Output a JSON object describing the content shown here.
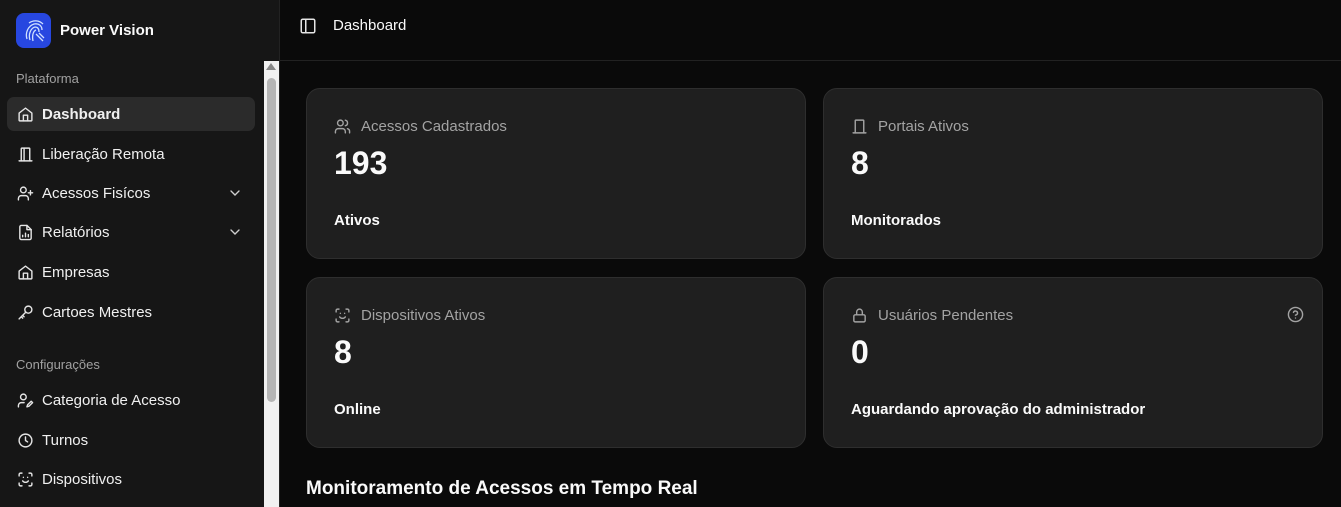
{
  "brand": {
    "name": "Power Vision"
  },
  "sidebar": {
    "groups": [
      {
        "label": "Plataforma"
      },
      {
        "label": "Configurações"
      }
    ],
    "items": [
      {
        "label": "Dashboard",
        "icon": "home-icon"
      },
      {
        "label": "Liberação Remota",
        "icon": "door-icon"
      },
      {
        "label": "Acessos Fisícos",
        "icon": "user-plus-icon"
      },
      {
        "label": "Relatórios",
        "icon": "report-icon"
      },
      {
        "label": "Empresas",
        "icon": "home-icon"
      },
      {
        "label": "Cartoes Mestres",
        "icon": "key-icon"
      },
      {
        "label": "Categoria de Acesso",
        "icon": "user-pen-icon"
      },
      {
        "label": "Turnos",
        "icon": "clock-icon"
      },
      {
        "label": "Dispositivos",
        "icon": "scan-face-icon"
      }
    ]
  },
  "header": {
    "title": "Dashboard"
  },
  "cards": [
    {
      "title": "Acessos Cadastrados",
      "value": "193",
      "sub": "Ativos",
      "icon": "users-icon"
    },
    {
      "title": "Portais Ativos",
      "value": "8",
      "sub": "Monitorados",
      "icon": "door-icon"
    },
    {
      "title": "Dispositivos Ativos",
      "value": "8",
      "sub": "Online",
      "icon": "scan-face-icon"
    },
    {
      "title": "Usuários Pendentes",
      "value": "0",
      "sub": "Aguardando aprovação do administrador",
      "icon": "lock-icon"
    }
  ],
  "section": {
    "title": "Monitoramento de Acessos em Tempo Real"
  },
  "colors": {
    "background": "#0a0a0a",
    "sidebar": "#161616",
    "card": "#1f1f1f",
    "accent": "#2747e0",
    "muted_text": "#a3a3a3"
  }
}
